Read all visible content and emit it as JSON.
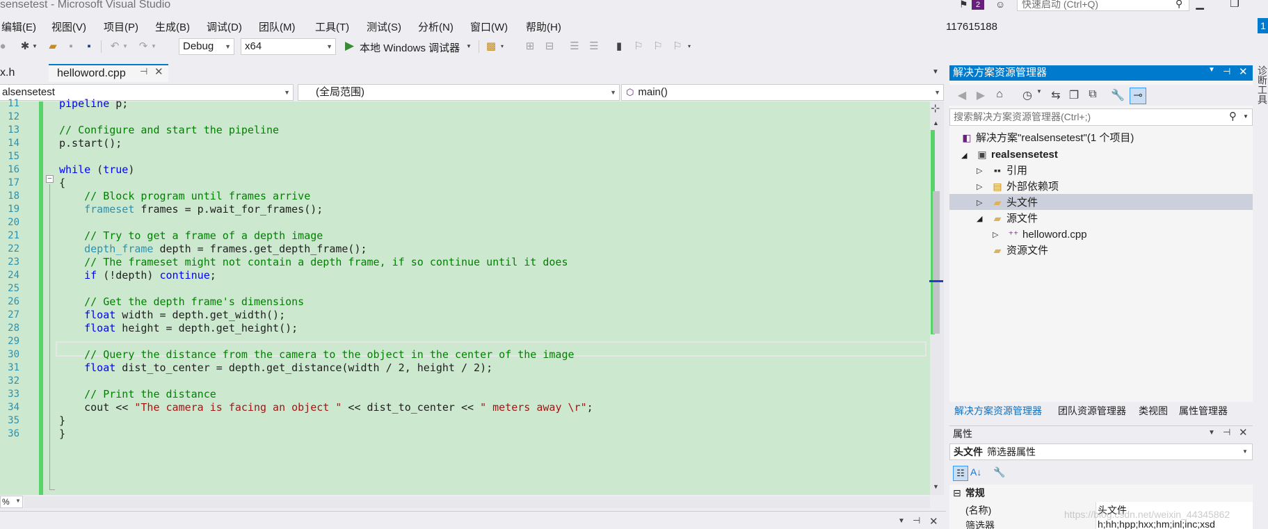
{
  "window": {
    "title": "sensetest - Microsoft Visual Studio",
    "notification_count": "2",
    "quick_launch_placeholder": "快速启动 (Ctrl+Q)"
  },
  "menu": [
    "编辑(E)",
    "视图(V)",
    "项目(P)",
    "生成(B)",
    "调试(D)",
    "团队(M)",
    "工具(T)",
    "测试(S)",
    "分析(N)",
    "窗口(W)",
    "帮助(H)"
  ],
  "account": {
    "id": "117615188",
    "avatar": "1"
  },
  "toolbar": {
    "config": "Debug",
    "platform": "x64",
    "run_label": "本地 Windows 调试器"
  },
  "tabs": {
    "left": "x.h",
    "active": "helloword.cpp"
  },
  "navbar": {
    "project": "alsensetest",
    "scope": "(全局范围)",
    "member": "main()"
  },
  "editor": {
    "lines": [
      {
        "n": "11",
        "tokens": [
          [
            "k",
            "pipeline"
          ],
          [
            "",
            " p;"
          ]
        ]
      },
      {
        "n": "12",
        "tokens": []
      },
      {
        "n": "13",
        "tokens": [
          [
            "c",
            "// Configure and start the pipeline"
          ]
        ]
      },
      {
        "n": "14",
        "tokens": [
          [
            "",
            "p.start();"
          ]
        ]
      },
      {
        "n": "15",
        "tokens": []
      },
      {
        "n": "16",
        "tokens": [
          [
            "k",
            "while"
          ],
          [
            "",
            " ("
          ],
          [
            "k",
            "true"
          ],
          [
            "",
            ")"
          ]
        ]
      },
      {
        "n": "17",
        "tokens": [
          [
            "",
            "{"
          ]
        ]
      },
      {
        "n": "18",
        "tokens": [
          [
            "",
            "    "
          ],
          [
            "c",
            "// Block program until frames arrive"
          ]
        ]
      },
      {
        "n": "19",
        "tokens": [
          [
            "",
            "    "
          ],
          [
            "t",
            "frameset"
          ],
          [
            "",
            " frames = p.wait_for_frames();"
          ]
        ]
      },
      {
        "n": "20",
        "tokens": []
      },
      {
        "n": "21",
        "tokens": [
          [
            "",
            "    "
          ],
          [
            "c",
            "// Try to get a frame of a depth image"
          ]
        ]
      },
      {
        "n": "22",
        "tokens": [
          [
            "",
            "    "
          ],
          [
            "t",
            "depth_frame"
          ],
          [
            "",
            " depth = frames.get_depth_frame();"
          ]
        ]
      },
      {
        "n": "23",
        "tokens": [
          [
            "",
            "    "
          ],
          [
            "c",
            "// The frameset might not contain a depth frame, if so continue until it does"
          ]
        ]
      },
      {
        "n": "24",
        "tokens": [
          [
            "",
            "    "
          ],
          [
            "k",
            "if"
          ],
          [
            "",
            " (!depth) "
          ],
          [
            "k",
            "continue"
          ],
          [
            "",
            ";"
          ]
        ]
      },
      {
        "n": "25",
        "tokens": []
      },
      {
        "n": "26",
        "tokens": [
          [
            "",
            "    "
          ],
          [
            "c",
            "// Get the depth frame's dimensions"
          ]
        ]
      },
      {
        "n": "27",
        "tokens": [
          [
            "",
            "    "
          ],
          [
            "k",
            "float"
          ],
          [
            "",
            " width = depth.get_width();"
          ]
        ]
      },
      {
        "n": "28",
        "tokens": [
          [
            "",
            "    "
          ],
          [
            "k",
            "float"
          ],
          [
            "",
            " height = depth.get_height();"
          ]
        ]
      },
      {
        "n": "29",
        "tokens": []
      },
      {
        "n": "30",
        "tokens": [
          [
            "",
            "    "
          ],
          [
            "c",
            "// Query the distance from the camera to the object in the center of the image"
          ]
        ]
      },
      {
        "n": "31",
        "tokens": [
          [
            "",
            "    "
          ],
          [
            "k",
            "float"
          ],
          [
            "",
            " dist_to_center = depth.get_distance(width / 2, height / 2);"
          ]
        ]
      },
      {
        "n": "32",
        "tokens": []
      },
      {
        "n": "33",
        "tokens": [
          [
            "",
            "    "
          ],
          [
            "c",
            "// Print the distance"
          ]
        ]
      },
      {
        "n": "34",
        "tokens": [
          [
            "",
            "    cout << "
          ],
          [
            "s",
            "\"The camera is facing an object \""
          ],
          [
            "",
            " << dist_to_center << "
          ],
          [
            "s",
            "\" meters away \\r\""
          ],
          [
            "",
            ";"
          ]
        ]
      },
      {
        "n": "35",
        "tokens": [
          [
            "",
            "}"
          ]
        ]
      },
      {
        "n": "36",
        "tokens": [
          [
            "",
            "}"
          ]
        ]
      }
    ],
    "zoom": "%"
  },
  "solution_explorer": {
    "title": "解决方案资源管理器",
    "search_placeholder": "搜索解决方案资源管理器(Ctrl+;)",
    "tree": [
      {
        "label": "解决方案\"realsensetest\"(1 个项目)",
        "icon": "solution-icon"
      },
      {
        "label": "realsensetest",
        "icon": "project-icon"
      },
      {
        "label": "引用",
        "icon": "references-icon"
      },
      {
        "label": "外部依赖项",
        "icon": "external-deps-icon"
      },
      {
        "label": "头文件",
        "icon": "folder-icon"
      },
      {
        "label": "源文件",
        "icon": "folder-icon"
      },
      {
        "label": "helloword.cpp",
        "icon": "cpp-file-icon"
      },
      {
        "label": "资源文件",
        "icon": "folder-icon"
      }
    ],
    "tabs": [
      "解决方案资源管理器",
      "团队资源管理器",
      "类视图",
      "属性管理器"
    ]
  },
  "properties": {
    "title": "属性",
    "object_name": "头文件",
    "object_type": "筛选器属性",
    "category": "常规",
    "rows": [
      {
        "name": "(名称)",
        "value": "头文件"
      },
      {
        "name": "筛选器",
        "value": "h;hh;hpp;hxx;hm;inl;inc;xsd"
      }
    ]
  },
  "side_label": "诊断工具",
  "watermark": "https://blog.csdn.net/weixin_44345862",
  "colors": {
    "accent": "#007acc",
    "editor_bg": "#cce8cf",
    "keyword": "#0000ff",
    "type": "#2b91af",
    "comment": "#008000",
    "string": "#a31515"
  }
}
